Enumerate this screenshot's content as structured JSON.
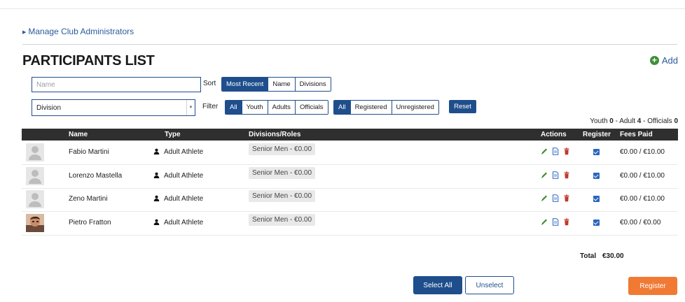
{
  "manage_link": "Manage Club Administrators",
  "title": "PARTICIPANTS LIST",
  "add_label": "Add",
  "search": {
    "placeholder": "Name",
    "value": ""
  },
  "division_select": {
    "value": "Division"
  },
  "sort": {
    "label": "Sort",
    "options": [
      "Most Recent",
      "Name",
      "Divisions"
    ],
    "active": 0
  },
  "filter": {
    "label": "Filter",
    "type_options": [
      "All",
      "Youth",
      "Adults",
      "Officials"
    ],
    "type_active": 0,
    "status_options": [
      "All",
      "Registered",
      "Unregistered"
    ],
    "status_active": 0,
    "reset_label": "Reset"
  },
  "counts": {
    "youth_label": "Youth",
    "youth": "0",
    "sep1": "-",
    "adult_label": "Adult",
    "adult": "4",
    "sep2": "-",
    "officials_label": "Officials",
    "officials": "0"
  },
  "table": {
    "headers": {
      "name": "Name",
      "type": "Type",
      "divisions": "Divisions/Roles",
      "actions": "Actions",
      "register": "Register",
      "fees": "Fees Paid"
    },
    "rows": [
      {
        "name": "Fabio Martini",
        "type": "Adult Athlete",
        "division": "Senior Men - €0.00",
        "fees": "€0.00 / €10.00",
        "avatar": "default-avatar"
      },
      {
        "name": "Lorenzo Mastella",
        "type": "Adult Athlete",
        "division": "Senior Men - €0.00",
        "fees": "€0.00 / €10.00",
        "avatar": "default-avatar"
      },
      {
        "name": "Zeno Martini",
        "type": "Adult Athlete",
        "division": "Senior Men - €0.00",
        "fees": "€0.00 / €10.00",
        "avatar": "default-avatar"
      },
      {
        "name": "Pietro Fratton",
        "type": "Adult Athlete",
        "division": "Senior Men - €0.00",
        "fees": "€0.00 / €0.00",
        "avatar": "photo-avatar"
      }
    ]
  },
  "total": {
    "label": "Total",
    "value": "€30.00"
  },
  "buttons": {
    "select_all": "Select All",
    "unselect": "Unselect",
    "register": "Register"
  },
  "colors": {
    "primary": "#1f4e8c",
    "accent": "#f07a34",
    "add_green": "#3f8f3a",
    "header_bg": "#2f2f2f",
    "edit_green": "#3a8a2e",
    "delete_red": "#c0392b"
  },
  "icons": {
    "edit": "pencil-icon",
    "document": "document-icon",
    "delete": "trash-icon",
    "person": "person-icon",
    "add": "plus-circle-icon"
  }
}
